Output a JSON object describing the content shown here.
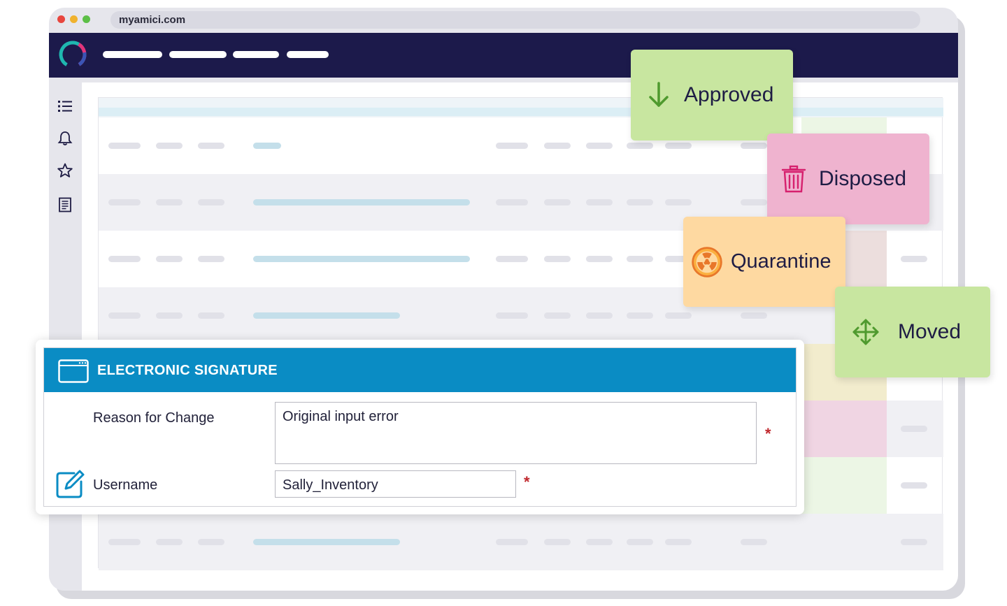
{
  "browser": {
    "url": "myamici.com",
    "dot_colors": [
      "#e8463e",
      "#f0b22e",
      "#5cbf47"
    ]
  },
  "app": {
    "nav_color": "#1c1a4b",
    "sidebar_icons": [
      "list-icon",
      "bell-icon",
      "star-icon",
      "document-icon"
    ]
  },
  "status_cards": {
    "approved": {
      "label": "Approved",
      "icon": "arrow-down-icon",
      "color": "#c8e6a0"
    },
    "disposed": {
      "label": "Disposed",
      "icon": "trash-icon",
      "color": "#efb3cf"
    },
    "quarantine": {
      "label": "Quarantine",
      "icon": "radiation-icon",
      "color": "#fed9a1"
    },
    "moved": {
      "label": "Moved",
      "icon": "move-arrows-icon",
      "color": "#c8e6a0"
    }
  },
  "signature_dialog": {
    "title": "ELECTRONIC SIGNATURE",
    "header_color": "#0a8cc4",
    "reason_label": "Reason for Change",
    "reason_value": "Original input error",
    "username_label": "Username",
    "username_value": "Sally_Inventory",
    "required_mark": "*"
  }
}
